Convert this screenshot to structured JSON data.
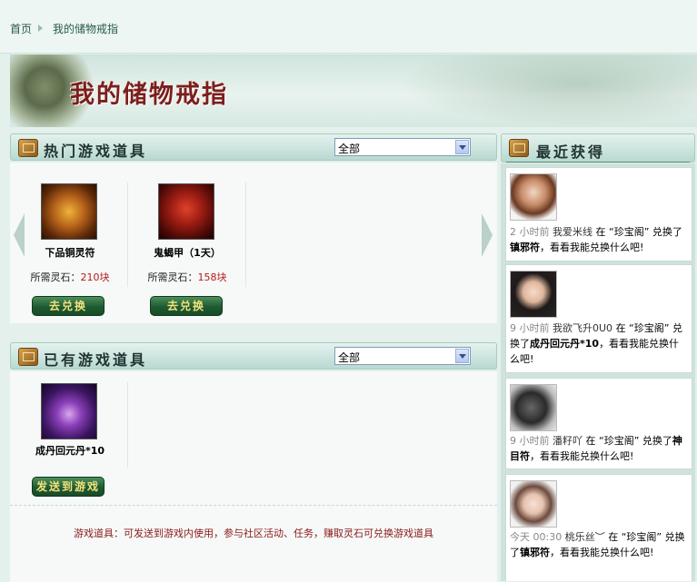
{
  "breadcrumb": {
    "home": "首页",
    "current": "我的储物戒指"
  },
  "banner": {
    "title": "我的储物戒指"
  },
  "hot_panel": {
    "title": "热门游戏道具",
    "filter_value": "全部",
    "items": [
      {
        "name": "下品铜灵符",
        "price_label": "所需灵石：",
        "price_value": "210块",
        "button": "去兑换"
      },
      {
        "name": "鬼蝎甲（1天）",
        "price_label": "所需灵石：",
        "price_value": "158块",
        "button": "去兑换"
      }
    ]
  },
  "owned_panel": {
    "title": "已有游戏道具",
    "filter_value": "全部",
    "items": [
      {
        "name": "成丹回元丹*10",
        "button": "发送到游戏"
      }
    ]
  },
  "footer_note": "游戏道具：可发送到游戏内使用，参与社区活动、任务，赚取灵石可兑换游戏道具",
  "recent": {
    "title": "最近获得",
    "entries": [
      {
        "time": "2 小时前",
        "user": "我爱米线",
        "mid": "在 “珍宝阁” 兑换了",
        "item": "镇邪符",
        "tail": "，看看我能兑换什么吧!"
      },
      {
        "time": "9 小时前",
        "user": "我欲飞升0U0",
        "mid": "在 “珍宝阁” 兑换了",
        "item": "成丹回元丹*10",
        "tail": "，看看我能兑换什么吧!"
      },
      {
        "time": "9 小时前",
        "user": "潘籽吖",
        "mid": "在 “珍宝阁” 兑换了",
        "item": "神目符",
        "tail": "，看看我能兑换什么吧!"
      },
      {
        "time": "今天 00:30",
        "user": "桃乐丝︶",
        "mid": "在 “珍宝阁” 兑换了",
        "item": "镇邪符",
        "tail": "，看看我能兑换什么吧!"
      }
    ]
  }
}
